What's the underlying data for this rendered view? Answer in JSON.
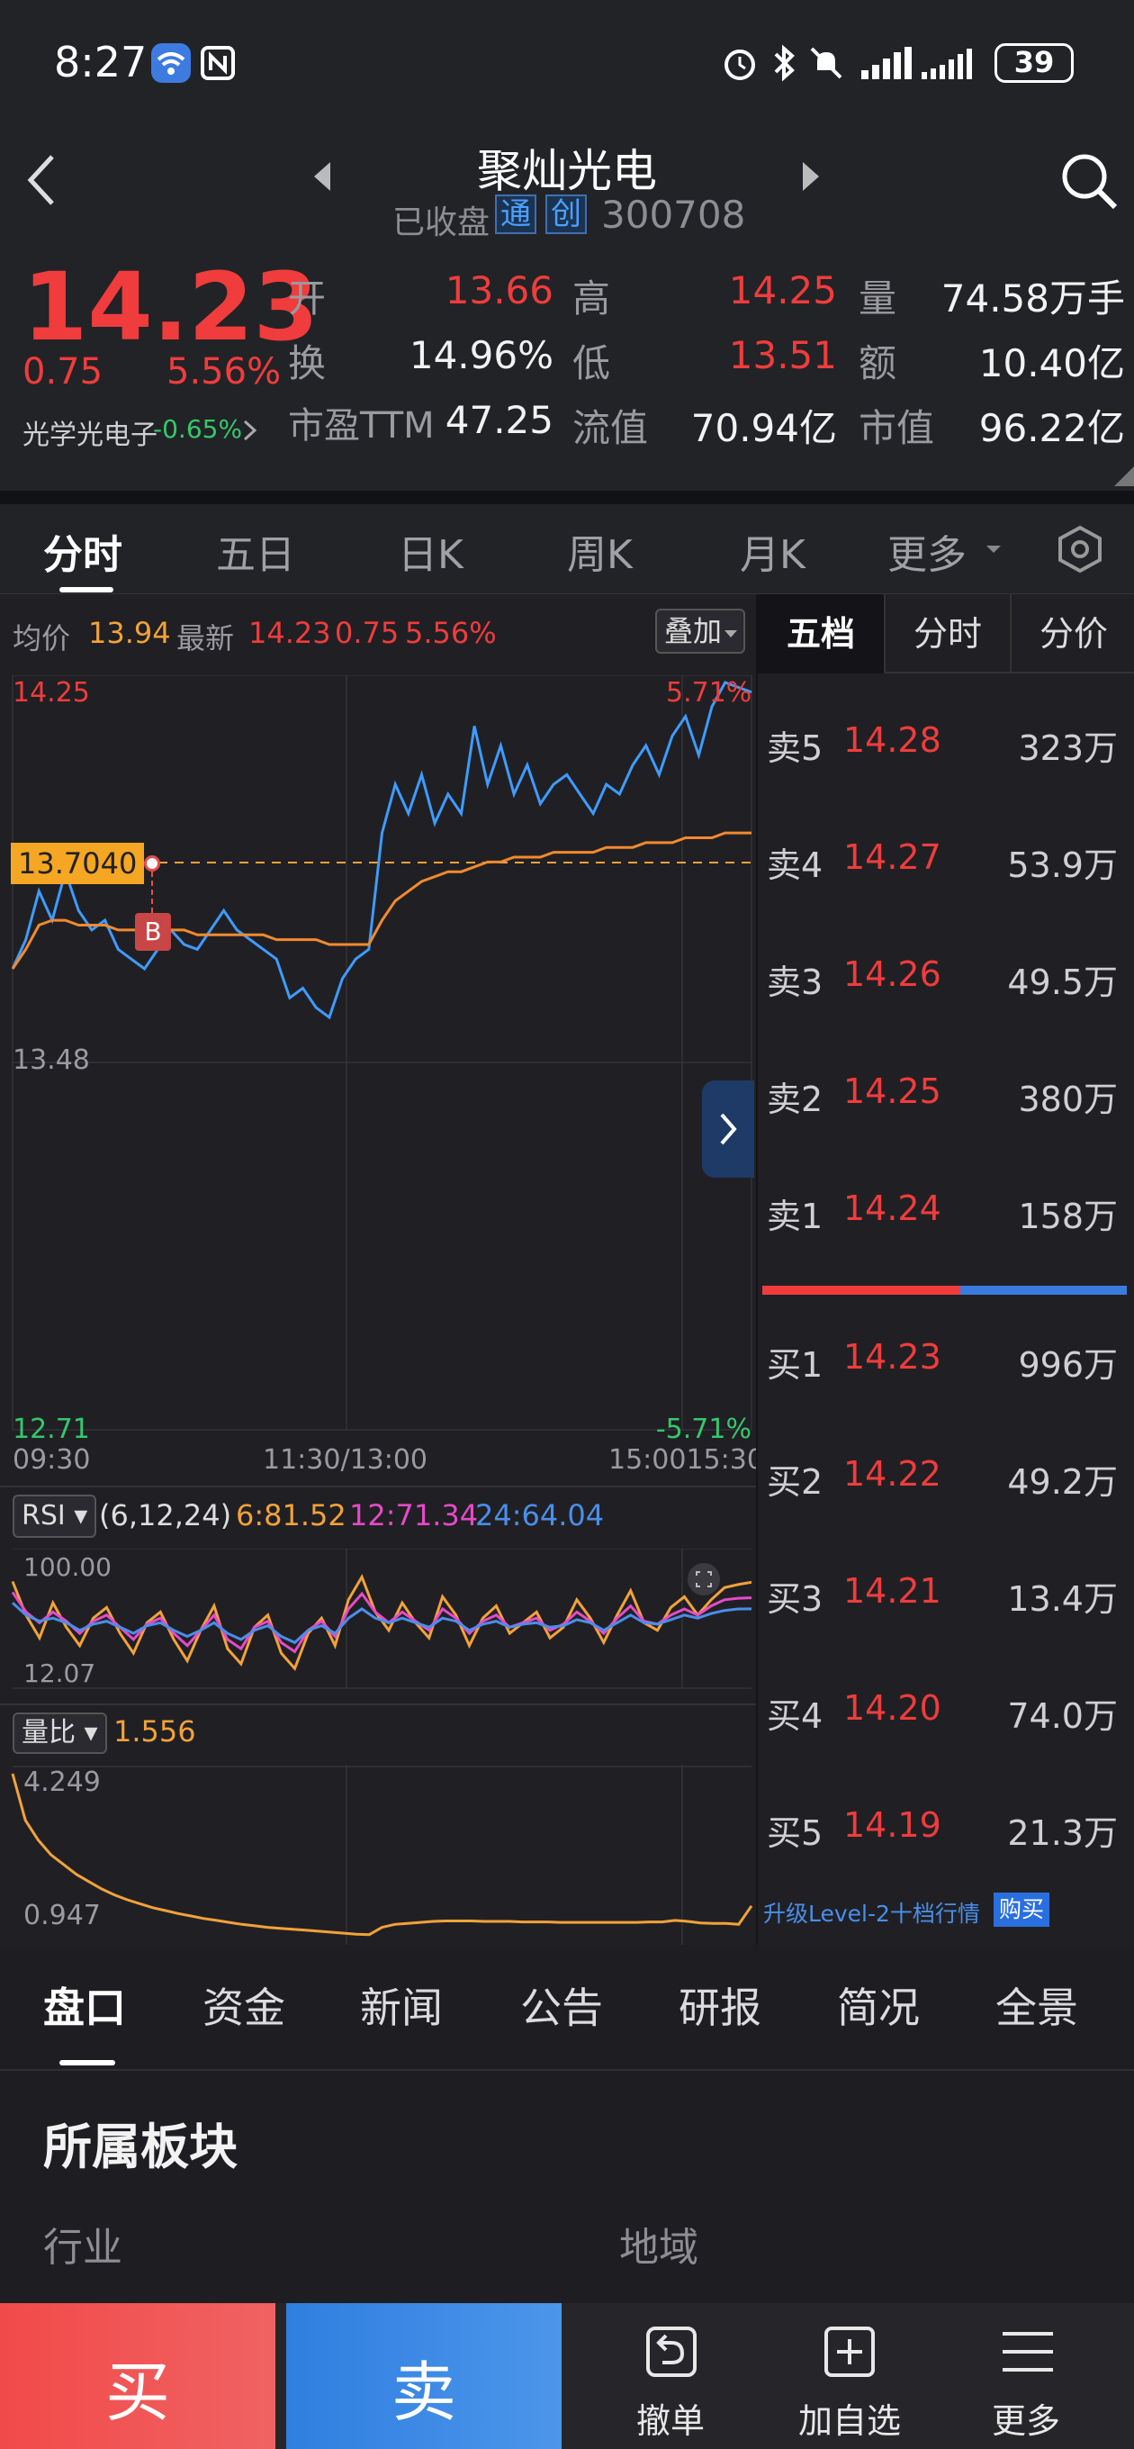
{
  "status_bar": {
    "time": "8:27",
    "battery": "39"
  },
  "header": {
    "stock_name": "聚灿光电",
    "market_status": "已收盘",
    "badge_tong": "通",
    "badge_chuang": "创",
    "code": "300708"
  },
  "quote": {
    "price": "14.23",
    "change": "0.75",
    "change_pct": "5.56%",
    "sector_name": "光学光电子",
    "sector_change": "-0.65%",
    "fields": [
      {
        "label": "开",
        "value": "13.66",
        "color": "red"
      },
      {
        "label": "高",
        "value": "14.25",
        "color": "red"
      },
      {
        "label": "量",
        "value": "74.58万手",
        "color": "white"
      },
      {
        "label": "换",
        "value": "14.96%",
        "color": "white"
      },
      {
        "label": "低",
        "value": "13.51",
        "color": "red"
      },
      {
        "label": "额",
        "value": "10.40亿",
        "color": "white"
      },
      {
        "label": "市盈TTM",
        "value": "47.25",
        "color": "white"
      },
      {
        "label": "流值",
        "value": "70.94亿",
        "color": "white"
      },
      {
        "label": "市值",
        "value": "96.22亿",
        "color": "white"
      }
    ]
  },
  "chart_tabs": [
    "分时",
    "五日",
    "日K",
    "周K",
    "月K",
    "更多"
  ],
  "chart_legend": {
    "avg_label": "均价",
    "avg_value": "13.94",
    "latest_label": "最新",
    "latest_value": "14.23",
    "latest_change": "0.75",
    "latest_pct": "5.56%",
    "overlay_button": "叠加"
  },
  "intraday": {
    "y_top": "14.25",
    "y_bottom": "12.71",
    "y_mid": "13.48",
    "pct_top": "5.71%",
    "pct_bottom": "-5.71%",
    "ref_price_tag": "13.7040",
    "marker": "B",
    "time_start": "09:30",
    "time_mid": "11:30/13:00",
    "time_end": "15:0015:30"
  },
  "chart_data": [
    {
      "type": "line",
      "title": "",
      "x_range": [
        "09:30",
        "15:00"
      ],
      "ylim": [
        12.71,
        14.25
      ],
      "series": [
        {
          "values": [
            13.66,
            13.72,
            13.82,
            13.76,
            13.86,
            13.78,
            13.74,
            13.76,
            13.7,
            13.68,
            13.66,
            13.7,
            13.74,
            13.71,
            13.7,
            13.74,
            13.78,
            13.74,
            13.72,
            13.7,
            13.68,
            13.6,
            13.62,
            13.58,
            13.56,
            13.64,
            13.68,
            13.7,
            13.94,
            14.04,
            13.98,
            14.06,
            13.96,
            14.02,
            13.98,
            14.16,
            14.04,
            14.12,
            14.02,
            14.08,
            14.0,
            14.04,
            14.06,
            14.02,
            13.98,
            14.04,
            14.02,
            14.08,
            14.12,
            14.06,
            14.14,
            14.18,
            14.1,
            14.2,
            14.25,
            14.24,
            14.23
          ]
        },
        {
          "values": [
            13.66,
            13.7,
            13.75,
            13.76,
            13.76,
            13.75,
            13.75,
            13.75,
            13.74,
            13.74,
            13.74,
            13.74,
            13.74,
            13.74,
            13.73,
            13.73,
            13.73,
            13.73,
            13.73,
            13.73,
            13.72,
            13.72,
            13.72,
            13.72,
            13.71,
            13.71,
            13.71,
            13.71,
            13.76,
            13.8,
            13.82,
            13.84,
            13.85,
            13.86,
            13.86,
            13.87,
            13.88,
            13.88,
            13.89,
            13.89,
            13.89,
            13.9,
            13.9,
            13.9,
            13.9,
            13.91,
            13.91,
            13.91,
            13.92,
            13.92,
            13.92,
            13.93,
            13.93,
            13.93,
            13.94,
            13.94,
            13.94
          ]
        }
      ]
    },
    {
      "type": "line",
      "title": "",
      "ylim": [
        12.07,
        100.0
      ],
      "series": [
        {
          "values": [
            82,
            60,
            45,
            68,
            52,
            40,
            58,
            65,
            48,
            35,
            55,
            62,
            44,
            30,
            50,
            66,
            38,
            28,
            52,
            60,
            35,
            25,
            48,
            58,
            40,
            70,
            85,
            62,
            50,
            68,
            55,
            45,
            72,
            60,
            40,
            58,
            66,
            48,
            55,
            62,
            45,
            52,
            70,
            58,
            42,
            60,
            76,
            55,
            50,
            65,
            72,
            60,
            70,
            78,
            80,
            81.52
          ]
        },
        {
          "values": [
            75,
            62,
            55,
            62,
            56,
            48,
            56,
            60,
            52,
            44,
            54,
            58,
            48,
            40,
            50,
            60,
            44,
            38,
            52,
            56,
            42,
            36,
            50,
            56,
            46,
            64,
            74,
            62,
            55,
            62,
            56,
            50,
            64,
            58,
            48,
            56,
            60,
            52,
            55,
            58,
            50,
            54,
            62,
            56,
            48,
            58,
            66,
            56,
            54,
            60,
            64,
            60,
            66,
            70,
            71,
            71.34
          ]
        },
        {
          "values": [
            68,
            60,
            56,
            58,
            55,
            50,
            54,
            56,
            52,
            48,
            53,
            55,
            50,
            46,
            50,
            55,
            48,
            44,
            50,
            53,
            46,
            42,
            50,
            53,
            48,
            58,
            64,
            58,
            55,
            58,
            55,
            52,
            58,
            56,
            50,
            54,
            56,
            52,
            54,
            55,
            52,
            53,
            57,
            55,
            50,
            55,
            60,
            55,
            54,
            57,
            60,
            58,
            61,
            63,
            64,
            64.04
          ]
        }
      ]
    },
    {
      "type": "line",
      "title": "",
      "ylim": [
        0.947,
        4.249
      ],
      "series": [
        {
          "values": [
            4.249,
            3.3,
            2.9,
            2.6,
            2.4,
            2.2,
            2.05,
            1.9,
            1.78,
            1.68,
            1.6,
            1.52,
            1.46,
            1.4,
            1.35,
            1.3,
            1.26,
            1.22,
            1.18,
            1.15,
            1.12,
            1.1,
            1.08,
            1.06,
            1.04,
            1.02,
            1.0,
            0.98,
            0.97,
            1.12,
            1.18,
            1.2,
            1.22,
            1.24,
            1.25,
            1.25,
            1.25,
            1.24,
            1.24,
            1.24,
            1.23,
            1.23,
            1.23,
            1.22,
            1.22,
            1.22,
            1.22,
            1.22,
            1.22,
            1.22,
            1.23,
            1.23,
            1.26,
            1.24,
            1.21,
            1.2,
            1.2,
            1.18,
            1.556
          ]
        }
      ]
    }
  ],
  "rsi": {
    "label": "RSI",
    "params": "(6,12,24)",
    "v6": "6:81.52",
    "v12": "12:71.34",
    "v24": "24:64.04",
    "top": "100.00",
    "bottom": "12.07"
  },
  "volume_ratio": {
    "label": "量比",
    "value": "1.556",
    "top": "4.249",
    "bottom": "0.947"
  },
  "order_book": {
    "tabs": [
      "五档",
      "分时",
      "分价"
    ],
    "asks": [
      {
        "label": "卖5",
        "price": "14.28",
        "volume": "323万"
      },
      {
        "label": "卖4",
        "price": "14.27",
        "volume": "53.9万"
      },
      {
        "label": "卖3",
        "price": "14.26",
        "volume": "49.5万"
      },
      {
        "label": "卖2",
        "price": "14.25",
        "volume": "380万"
      },
      {
        "label": "卖1",
        "price": "14.24",
        "volume": "158万"
      }
    ],
    "bids": [
      {
        "label": "买1",
        "price": "14.23",
        "volume": "996万"
      },
      {
        "label": "买2",
        "price": "14.22",
        "volume": "49.2万"
      },
      {
        "label": "买3",
        "price": "14.21",
        "volume": "13.4万"
      },
      {
        "label": "买4",
        "price": "14.20",
        "volume": "74.0万"
      },
      {
        "label": "买5",
        "price": "14.19",
        "volume": "21.3万"
      }
    ],
    "upgrade_text": "升级Level-2十档行情",
    "buy_badge": "购买"
  },
  "bottom_tabs": [
    "盘口",
    "资金",
    "新闻",
    "公告",
    "研报",
    "简况",
    "全景"
  ],
  "sector_section": {
    "title": "所属板块",
    "industry_label": "行业",
    "region_label": "地域"
  },
  "footer": {
    "buy": "买",
    "sell": "卖",
    "cancel": "撤单",
    "add_watch": "加自选",
    "more": "更多"
  }
}
